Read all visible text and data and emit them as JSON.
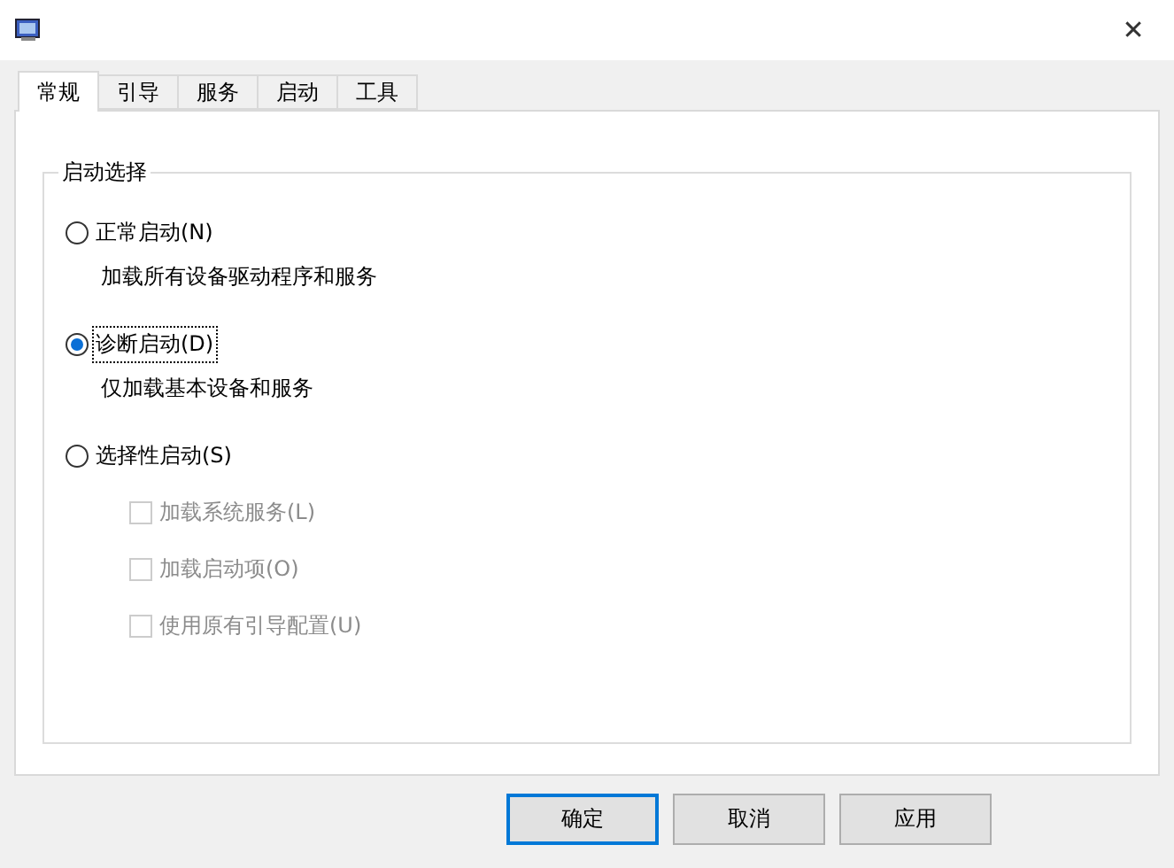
{
  "window": {
    "close": "✕"
  },
  "tabs": [
    {
      "label": "常规",
      "selected": true
    },
    {
      "label": "引导",
      "selected": false
    },
    {
      "label": "服务",
      "selected": false
    },
    {
      "label": "启动",
      "selected": false
    },
    {
      "label": "工具",
      "selected": false
    }
  ],
  "group": {
    "title": "启动选择",
    "options": [
      {
        "label": "正常启动(N)",
        "selected": false,
        "focused": false,
        "description": "加载所有设备驱动程序和服务"
      },
      {
        "label": "诊断启动(D)",
        "selected": true,
        "focused": true,
        "description": "仅加载基本设备和服务"
      },
      {
        "label": "选择性启动(S)",
        "selected": false,
        "focused": false,
        "checkboxes": [
          {
            "label": "加载系统服务(L)",
            "checked": false,
            "disabled": true
          },
          {
            "label": "加载启动项(O)",
            "checked": false,
            "disabled": true
          },
          {
            "label": "使用原有引导配置(U)",
            "checked": false,
            "disabled": true
          }
        ]
      }
    ]
  },
  "buttons": [
    {
      "label": "确定",
      "default": true
    },
    {
      "label": "取消",
      "default": false
    },
    {
      "label": "应用",
      "default": false
    }
  ]
}
